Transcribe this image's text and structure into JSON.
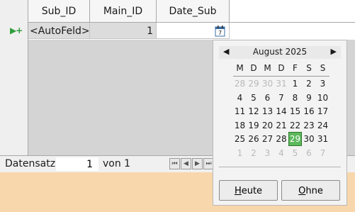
{
  "grid": {
    "columns": [
      "Sub_ID",
      "Main_ID",
      "Date_Sub"
    ],
    "row": {
      "sub_id": "<AutoFeld>",
      "main_id": "1",
      "date_sub": ""
    },
    "row_marker": "▶+"
  },
  "navbar": {
    "label": "Datensatz",
    "record": "1",
    "of_label": "von 1"
  },
  "calendar": {
    "month_label": "August 2025",
    "weekdays": [
      "M",
      "D",
      "M",
      "D",
      "F",
      "S",
      "S"
    ],
    "weeks": [
      [
        "28",
        "29",
        "30",
        "31",
        "1",
        "2",
        "3"
      ],
      [
        "4",
        "5",
        "6",
        "7",
        "8",
        "9",
        "10"
      ],
      [
        "11",
        "12",
        "13",
        "14",
        "15",
        "16",
        "17"
      ],
      [
        "18",
        "19",
        "20",
        "21",
        "22",
        "23",
        "24"
      ],
      [
        "25",
        "26",
        "27",
        "28",
        "29",
        "30",
        "31"
      ],
      [
        "1",
        "2",
        "3",
        "4",
        "5",
        "6",
        "7"
      ]
    ],
    "today_button": "Heute",
    "none_button": "Ohne"
  },
  "colors": {
    "today": "#5cb85c",
    "background": "#f8d7ac"
  }
}
